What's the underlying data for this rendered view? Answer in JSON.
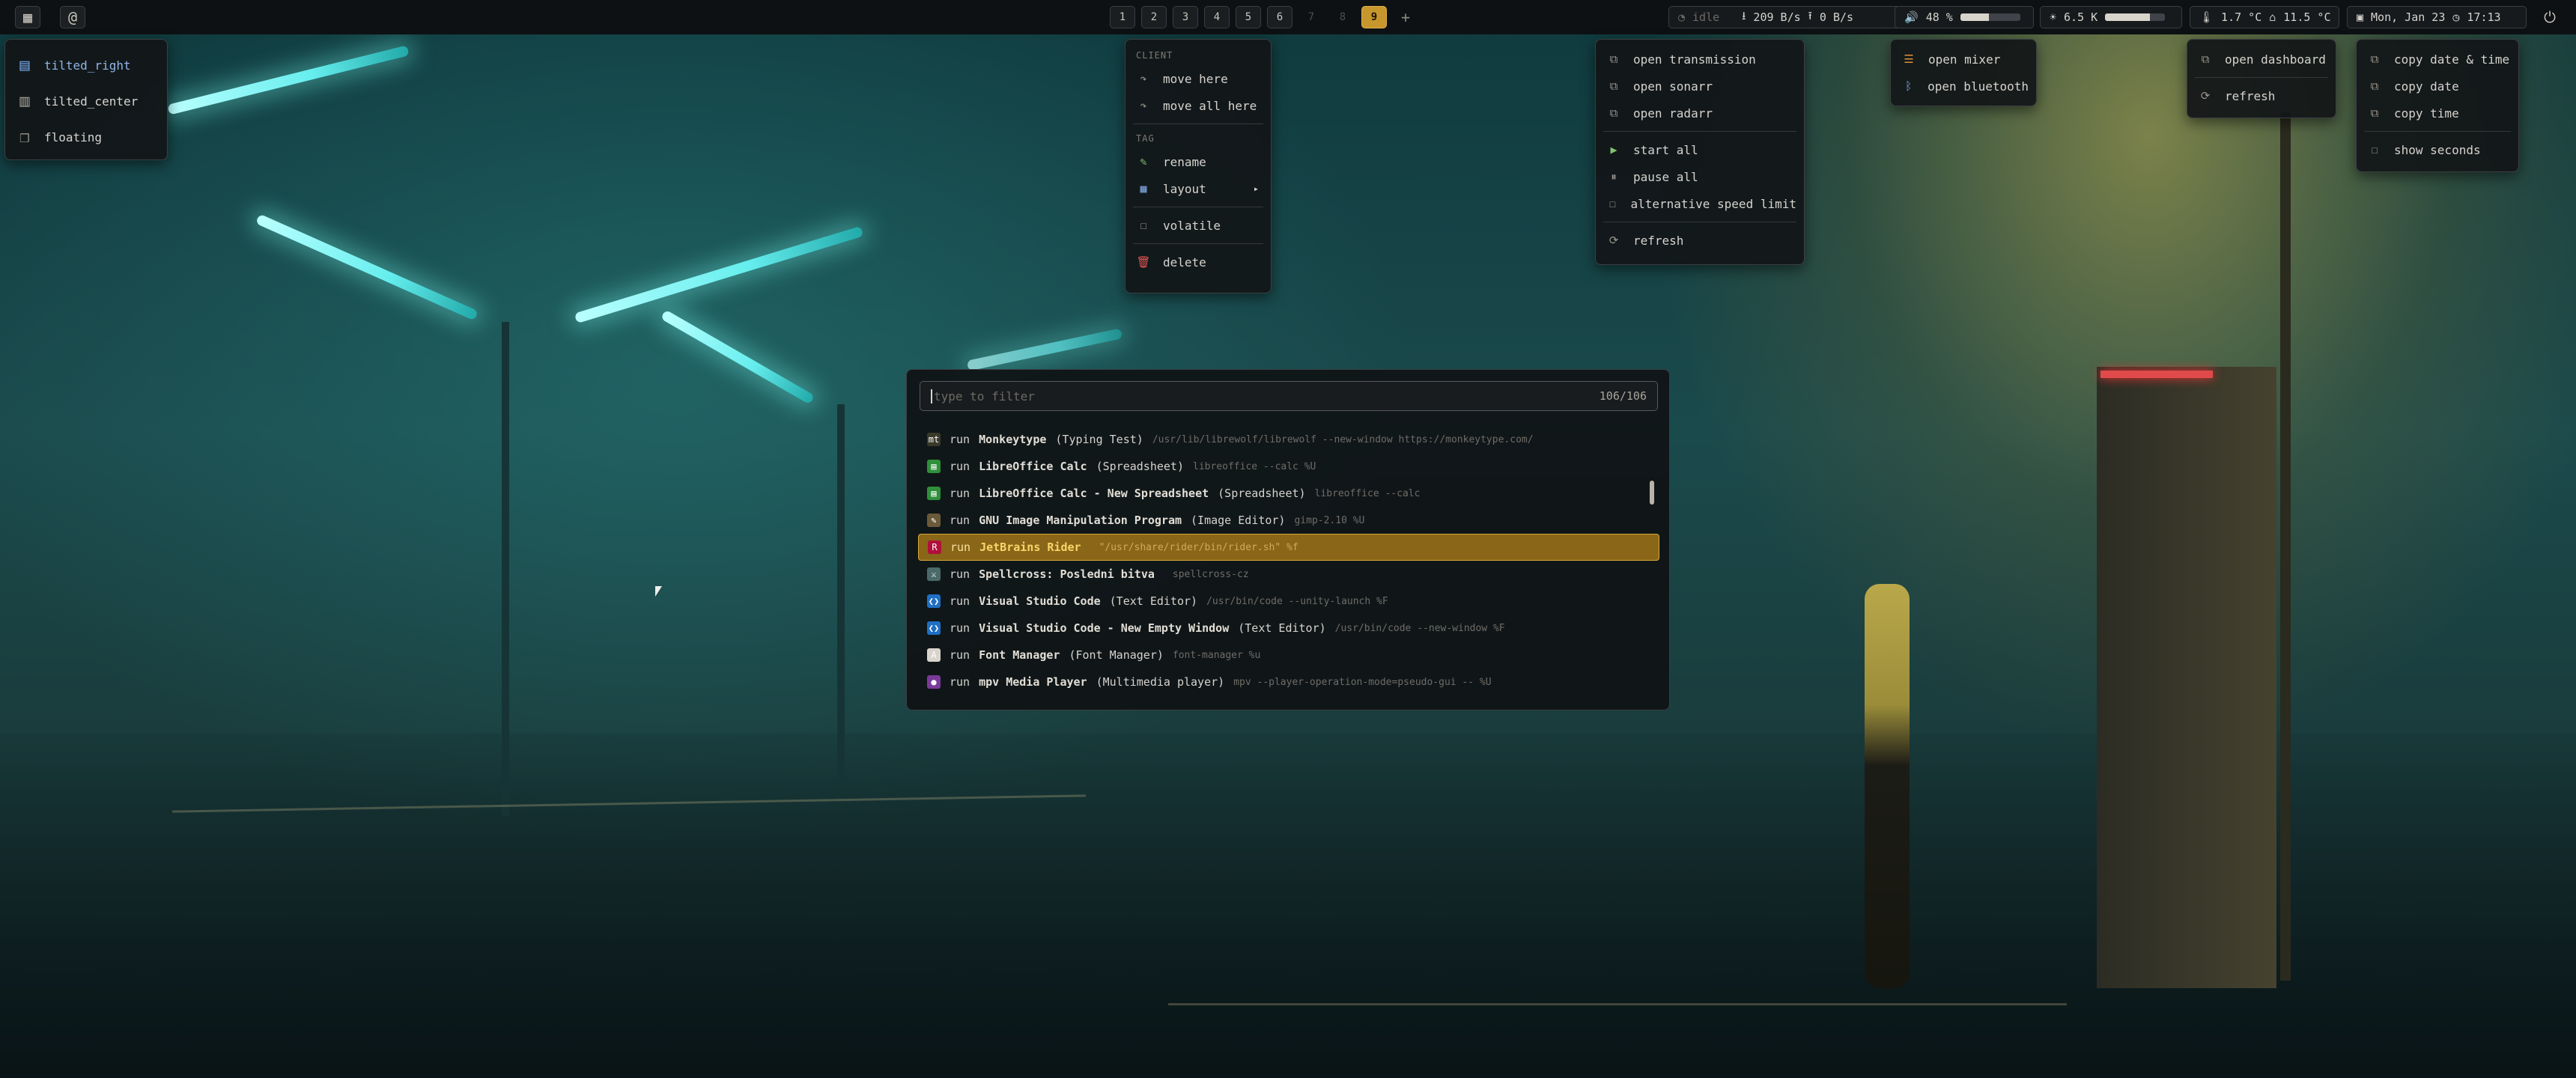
{
  "topbar": {
    "left_icons": [
      "layout-icon",
      "at-icon"
    ],
    "tags": [
      "1",
      "2",
      "3",
      "4",
      "5",
      "6",
      "7",
      "8",
      "9"
    ],
    "active_tag": "9",
    "add_tag": "+",
    "status": {
      "idle": "idle",
      "download": "209 B/s",
      "upload": "0 B/s",
      "volume": "48 %",
      "volume_level": 0.48,
      "brightness": "6.5 K",
      "brightness_level": 0.75,
      "temp_cpu": "1.7 °C",
      "temp_out": "11.5 °C",
      "date": "Mon, Jan 23",
      "time": "17:13"
    }
  },
  "layout_menu": {
    "items": [
      {
        "label": "tilted_right",
        "icon": "tiled-right-icon"
      },
      {
        "label": "tilted_center",
        "icon": "tiled-center-icon"
      },
      {
        "label": "floating",
        "icon": "floating-icon"
      }
    ]
  },
  "client_menu": {
    "client_header": "CLIENT",
    "client_items": [
      {
        "label": "move here",
        "icon": "move-icon"
      },
      {
        "label": "move all here",
        "icon": "move-icon"
      }
    ],
    "tag_header": "TAG",
    "tag_items": [
      {
        "label": "rename",
        "icon": "pencil-icon"
      },
      {
        "label": "layout",
        "icon": "grid-icon"
      },
      {
        "label": "volatile",
        "icon": "checkbox-icon"
      },
      {
        "label": "delete",
        "icon": "trash-icon"
      }
    ],
    "submenu_arrow": "▸"
  },
  "torrent_menu": {
    "links": [
      "open transmission",
      "open sonarr",
      "open radarr"
    ],
    "actions": [
      "start all",
      "pause all",
      "alternative speed limit"
    ],
    "refresh": "refresh"
  },
  "audio_menu": {
    "items": [
      "open mixer",
      "open bluetooth"
    ]
  },
  "dashboard_menu": {
    "items": [
      "open dashboard",
      "refresh"
    ]
  },
  "clock_menu": {
    "items": [
      "copy date & time",
      "copy date",
      "copy time"
    ],
    "toggle": "show seconds"
  },
  "launcher": {
    "placeholder": "type to filter",
    "count": "106/106",
    "rows": [
      {
        "verb": "run",
        "name": "Monkeytype",
        "genre": "(Typing Test)",
        "cmd": "/usr/lib/librewolf/librewolf --new-window https://monkeytype.com/",
        "icon": "mt",
        "color": "#3a3a2a"
      },
      {
        "verb": "run",
        "name": "LibreOffice Calc",
        "genre": "(Spreadsheet)",
        "cmd": "libreoffice --calc %U",
        "icon": "▤",
        "color": "#2f8f3a"
      },
      {
        "verb": "run",
        "name": "LibreOffice Calc - New Spreadsheet",
        "genre": "(Spreadsheet)",
        "cmd": "libreoffice --calc",
        "icon": "▤",
        "color": "#2f8f3a"
      },
      {
        "verb": "run",
        "name": "GNU Image Manipulation Program",
        "genre": "(Image Editor)",
        "cmd": "gimp-2.10 %U",
        "icon": "✎",
        "color": "#6b5a3a"
      },
      {
        "verb": "run",
        "name": "JetBrains Rider",
        "genre": "",
        "cmd": "\"/usr/share/rider/bin/rider.sh\" %f",
        "icon": "R",
        "color": "#b0103a"
      },
      {
        "verb": "run",
        "name": "Spellcross: Posledni bitva",
        "genre": "",
        "cmd": "spellcross-cz",
        "icon": "⚔",
        "color": "#4a6a6a"
      },
      {
        "verb": "run",
        "name": "Visual Studio Code",
        "genre": "(Text Editor)",
        "cmd": "/usr/bin/code --unity-launch %F",
        "icon": "❮❯",
        "color": "#1f6fc4"
      },
      {
        "verb": "run",
        "name": "Visual Studio Code - New Empty Window",
        "genre": "(Text Editor)",
        "cmd": "/usr/bin/code --new-window %F",
        "icon": "❮❯",
        "color": "#1f6fc4"
      },
      {
        "verb": "run",
        "name": "Font Manager",
        "genre": "(Font Manager)",
        "cmd": "font-manager %u",
        "icon": "A",
        "color": "#d8d4cc"
      },
      {
        "verb": "run",
        "name": "mpv Media Player",
        "genre": "(Multimedia player)",
        "cmd": "mpv --player-operation-mode=pseudo-gui -- %U",
        "icon": "●",
        "color": "#7a3a9a"
      }
    ],
    "selected_index": 4
  }
}
